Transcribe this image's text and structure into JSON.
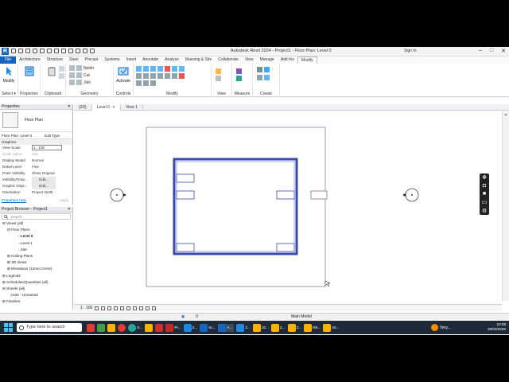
{
  "window": {
    "title": "Autodesk Revit 2024 - Project1 - Floor Plan: Level 0",
    "signin": "Sign In",
    "app_logo": "R"
  },
  "ribbon_tabs": [
    "File",
    "Architecture",
    "Structure",
    "Steel",
    "Precast",
    "Systems",
    "Insert",
    "Annotate",
    "Analyze",
    "Massing & Site",
    "Collaborate",
    "View",
    "Manage",
    "Add-Ins",
    "Modify"
  ],
  "ribbon": {
    "select_label": "Select ▾",
    "modify_label": "Modify",
    "properties_label": "Properties",
    "clipboard_label": "Clipboard",
    "geometry_label": "Geometry",
    "notch_label": "Notch",
    "cut_label": "Cut",
    "join_label": "Join",
    "controls_label": "Controls",
    "activate_label": "Activate",
    "modify_group_label": "Modify",
    "view_label": "View",
    "measure_label": "Measure",
    "create_label": "Create"
  },
  "view_tabs": [
    {
      "label": "{3D}"
    },
    {
      "label": "Level 0"
    },
    {
      "label": "View 1"
    }
  ],
  "properties": {
    "header": "Properties",
    "type_name": "Floor Plan",
    "selector": "Floor Plan: Level 0",
    "edit_type": "Edit Type",
    "section": "Graphics",
    "rows": [
      {
        "k": "View Scale",
        "v": "1 : 100"
      },
      {
        "k": "Scale Value",
        "v": "100"
      },
      {
        "k": "Display Model",
        "v": "Normal"
      },
      {
        "k": "Detail Level",
        "v": "Fine"
      },
      {
        "k": "Parts Visibility",
        "v": "Show Original"
      },
      {
        "k": "Visibility/Grap...",
        "v": "Edit..."
      },
      {
        "k": "Graphic Displ...",
        "v": "Edit..."
      },
      {
        "k": "Orientation",
        "v": "Project North"
      }
    ],
    "help": "Properties help",
    "apply": "Apply"
  },
  "browser": {
    "header": "Project Browser - Project1",
    "search_placeholder": "Search",
    "items": [
      "Views (all)",
      "Floor Plans",
      "Level 0",
      "Level 1",
      "Site",
      "Ceiling Plans",
      "3D Views",
      "Elevations (12mm Circle)",
      "Legends",
      "Schedules/Quantities (all)",
      "Sheets (all)",
      "A100 - Unnamed",
      "Families"
    ]
  },
  "view_status": {
    "scale": "1 : 100"
  },
  "status_bar": {
    "model": "Main Model",
    "value": "0"
  },
  "taskbar": {
    "search": "Type here to search",
    "apps": [
      "G...",
      "Pr...",
      "Z...",
      "Sc...",
      "A...",
      "Z...",
      "20...",
      "Z...",
      "Z...",
      "RE...",
      "20..."
    ],
    "weather": "Very...",
    "time": "10:08",
    "date": "28/03/2025"
  },
  "colors": {
    "accent": "#1565c0",
    "wall": "#3949ab",
    "taskbar": "#1f2a38"
  }
}
